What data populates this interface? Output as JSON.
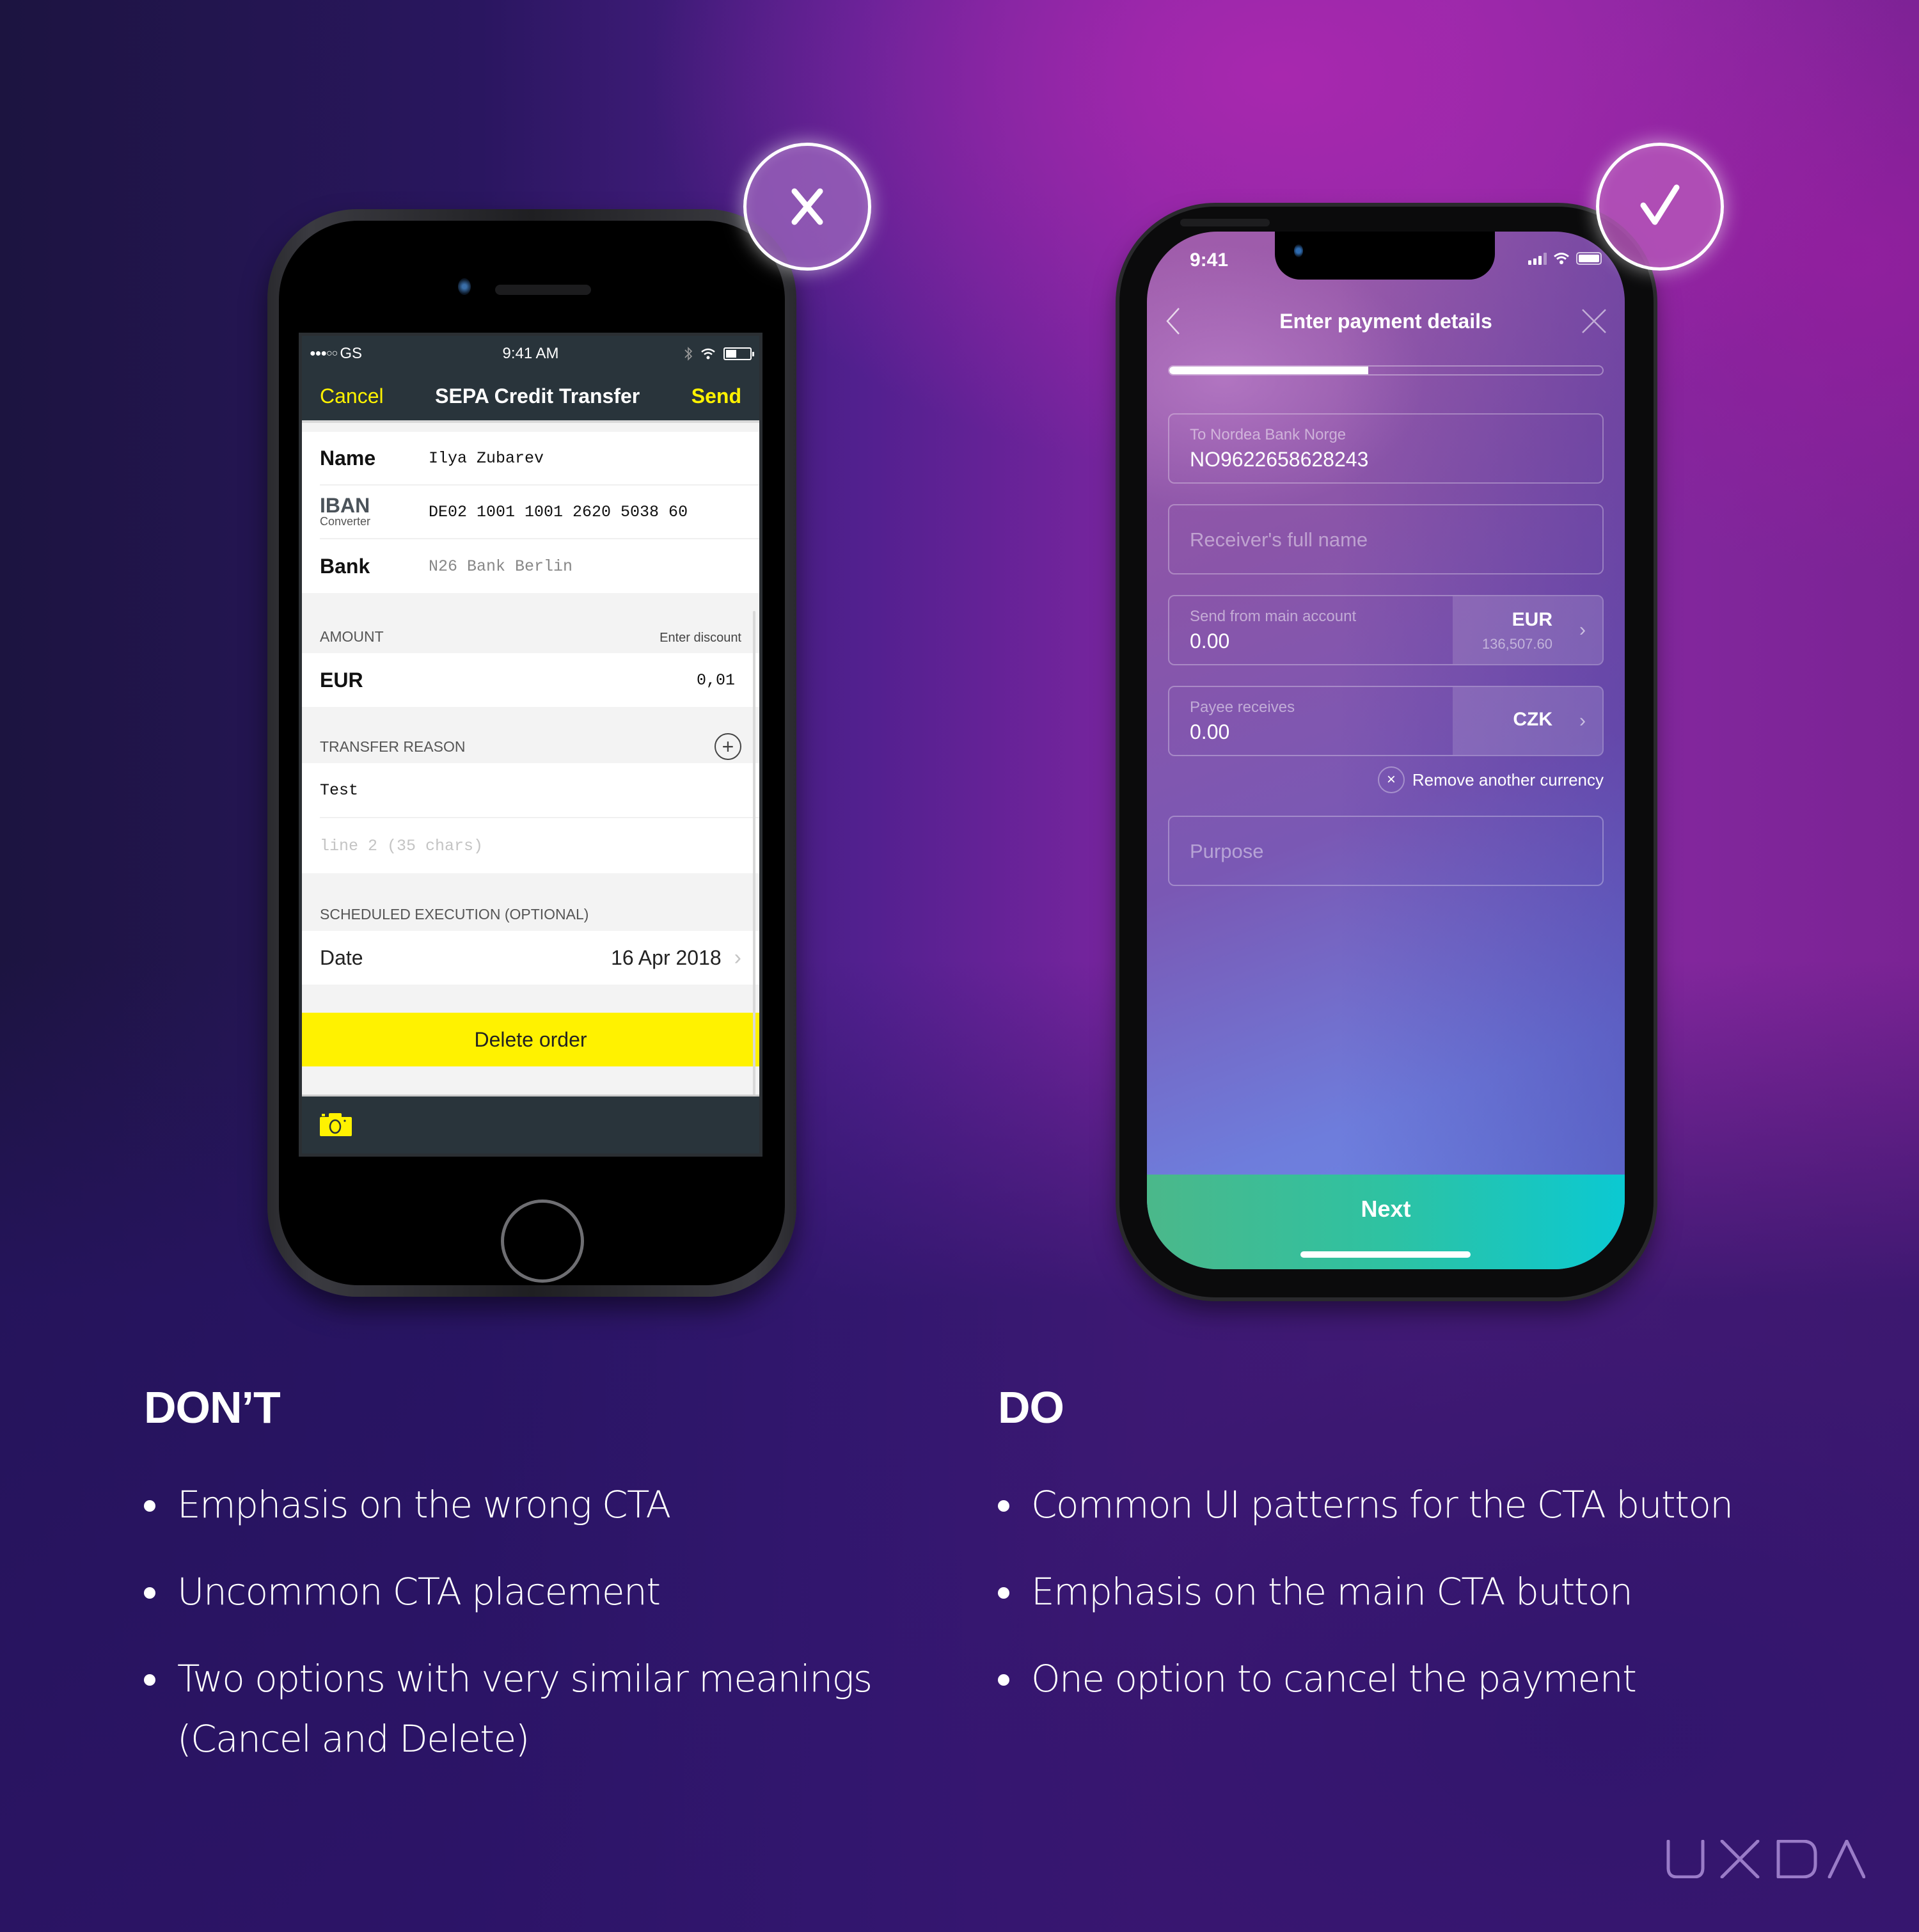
{
  "badges": {
    "dont": "x-mark",
    "do": "check-mark"
  },
  "phone_dont": {
    "status_bar": {
      "carrier": "GS",
      "signal_dots": "●●●○○",
      "time": "9:41 AM"
    },
    "nav": {
      "cancel_label": "Cancel",
      "title": "SEPA Credit Transfer",
      "send_label": "Send"
    },
    "recipient": [
      {
        "label": "Name",
        "sublabel": "",
        "value": "Ilya Zubarev"
      },
      {
        "label": "IBAN",
        "sublabel": "Converter",
        "value": "DE02 1001 1001 2620 5038 60"
      },
      {
        "label": "Bank",
        "sublabel": "",
        "value": "N26 Bank Berlin"
      }
    ],
    "amount": {
      "section_label": "AMOUNT",
      "discount_link": "Enter discount",
      "currency": "EUR",
      "value": "0,01"
    },
    "transfer_reason": {
      "section_label": "TRANSFER REASON",
      "line1": "Test",
      "line2_placeholder": "line 2 (35 chars)"
    },
    "scheduled": {
      "section_label": "SCHEDULED EXECUTION (OPTIONAL)",
      "date_label": "Date",
      "date_value": "16 Apr 2018"
    },
    "delete_label": "Delete order",
    "accent_color": "#fff200",
    "bar_color": "#29343b"
  },
  "phone_do": {
    "status_bar": {
      "time": "9:41"
    },
    "header": {
      "title": "Enter payment details"
    },
    "progress": 0.46,
    "fields": {
      "account": {
        "label": "To Nordea Bank Norge",
        "value": "NO9622658628243"
      },
      "receiver": {
        "placeholder": "Receiver's full name"
      },
      "send_from": {
        "label": "Send from main account",
        "value": "0.00",
        "currency": "EUR",
        "balance": "136,507.60"
      },
      "payee_receives": {
        "label": "Payee receives",
        "value": "0.00",
        "currency": "CZK"
      },
      "purpose": {
        "placeholder": "Purpose"
      }
    },
    "remove_currency_label": "Remove another currency",
    "next_label": "Next",
    "cta_gradient": [
      "#4bb88a",
      "#0bc9d2"
    ]
  },
  "dont_section": {
    "heading": "DON’T",
    "bullets": [
      "Emphasis on the wrong CTA",
      "Uncommon CTA placement",
      "Two options with very similar meanings (Cancel and Delete)"
    ]
  },
  "do_section": {
    "heading": "DO",
    "bullets": [
      "Common UI patterns for the CTA button",
      "Emphasis on the main CTA button",
      "One option to cancel the payment"
    ]
  },
  "brand": {
    "logo_text": "UXDA",
    "logo_color": "#9a7cc8"
  }
}
